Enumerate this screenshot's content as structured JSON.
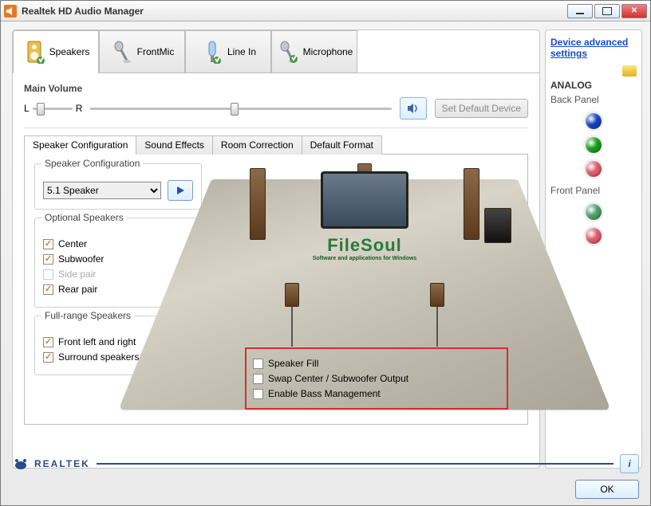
{
  "window": {
    "title": "Realtek HD Audio Manager"
  },
  "deviceTabs": [
    {
      "label": "Speakers",
      "name": "tab-speakers",
      "active": true
    },
    {
      "label": "FrontMic",
      "name": "tab-frontmic",
      "active": false
    },
    {
      "label": "Line In",
      "name": "tab-linein",
      "active": false
    },
    {
      "label": "Microphone",
      "name": "tab-microphone",
      "active": false
    }
  ],
  "mainVolume": {
    "label": "Main Volume",
    "left": "L",
    "right": "R",
    "balancePos": 20,
    "volumePos": 48,
    "defaultBtn": "Set Default Device"
  },
  "subTabs": [
    {
      "label": "Speaker Configuration",
      "active": true
    },
    {
      "label": "Sound Effects",
      "active": false
    },
    {
      "label": "Room Correction",
      "active": false
    },
    {
      "label": "Default Format",
      "active": false
    }
  ],
  "speakerConfig": {
    "groupTitle": "Speaker Configuration",
    "selected": "5.1 Speaker"
  },
  "optional": {
    "groupTitle": "Optional Speakers",
    "items": [
      {
        "label": "Center",
        "checked": true,
        "disabled": false
      },
      {
        "label": "Subwoofer",
        "checked": true,
        "disabled": false
      },
      {
        "label": "Side pair",
        "checked": false,
        "disabled": true
      },
      {
        "label": "Rear pair",
        "checked": true,
        "disabled": false
      }
    ]
  },
  "fullrange": {
    "groupTitle": "Full-range Speakers",
    "items": [
      {
        "label": "Front left and right",
        "checked": true
      },
      {
        "label": "Surround speakers",
        "checked": true
      }
    ]
  },
  "extra": {
    "items": [
      {
        "label": "Speaker Fill",
        "checked": false
      },
      {
        "label": "Swap Center / Subwoofer Output",
        "checked": false
      },
      {
        "label": "Enable Bass Management",
        "checked": false
      }
    ]
  },
  "watermark": {
    "big": "FileSoul",
    "small": "Software and applications for Windows"
  },
  "side": {
    "advanced": "Device advanced settings",
    "analog": "ANALOG",
    "back": "Back Panel",
    "front": "Front Panel",
    "jacksBack": [
      "#1040c0",
      "#10a010",
      "#e05a6a"
    ],
    "jacksFront": [
      "#4aa06a",
      "#e05a6a"
    ]
  },
  "brand": "REALTEK",
  "okBtn": "OK"
}
